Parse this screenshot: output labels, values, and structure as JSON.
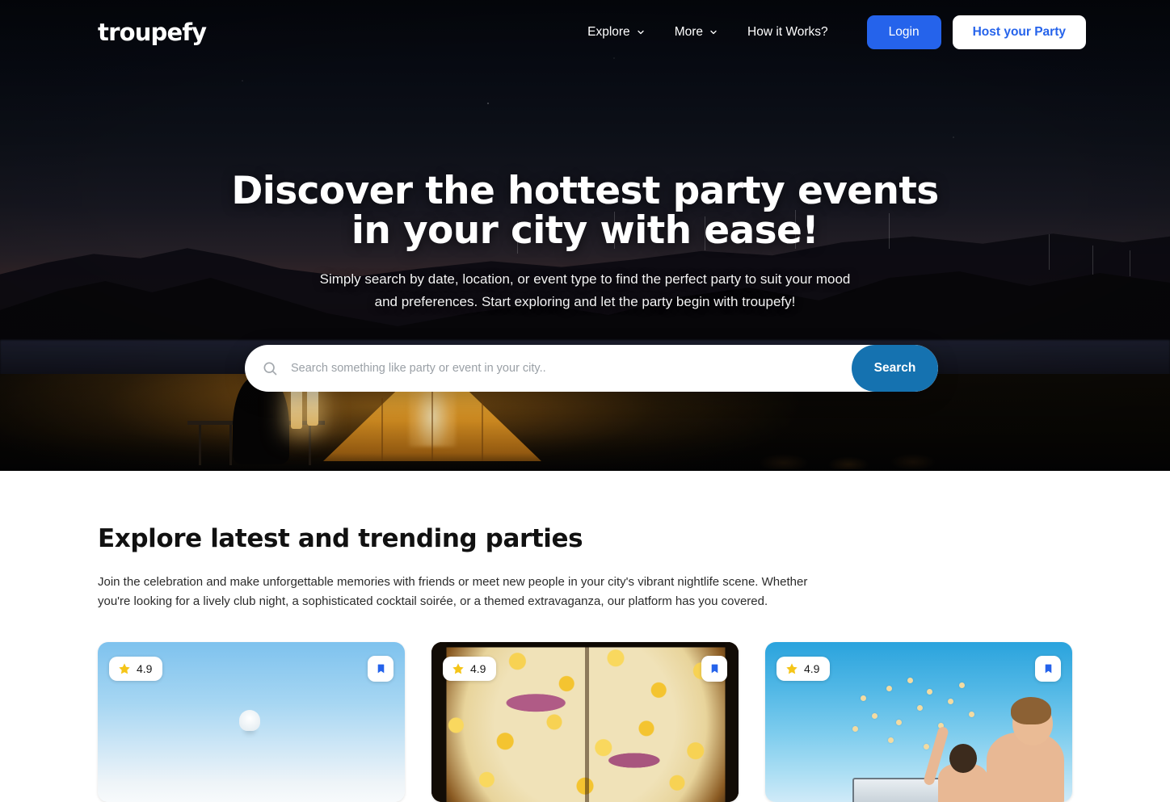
{
  "brand": {
    "logo_text": "troupefy"
  },
  "nav": {
    "links": [
      {
        "label": "Explore",
        "icon": "chevron-down-icon"
      },
      {
        "label": "More",
        "icon": "chevron-down-icon"
      },
      {
        "label": "How it Works?",
        "icon": ""
      }
    ],
    "login_label": "Login",
    "host_label": "Host your Party",
    "login_bg": "#2563EB",
    "host_text_color": "#2563EB"
  },
  "hero": {
    "title_line1": "Discover the hottest party events",
    "title_line2": "in your city with ease!",
    "subtitle_line1": "Simply search by date, location, or event type to find the perfect party to suit your mood",
    "subtitle_line2": "and preferences. Start exploring and let the party begin with troupefy!"
  },
  "search": {
    "icon": "search-icon",
    "placeholder": "Search something like party or event in your city..",
    "value": "",
    "button_label": "Search",
    "button_bg": "#1572B0"
  },
  "explore": {
    "heading": "Explore latest and trending parties",
    "description": "Join the celebration and make unforgettable memories with friends or meet new people in your city's vibrant nightlife scene. Whether you're looking for a lively club night, a sophisticated cocktail soirée, or a themed extravaganza, our platform has you covered.",
    "cards": [
      {
        "rating": "4.9",
        "rating_icon": "star-icon",
        "bookmark_icon": "bookmark-icon",
        "media": "sky"
      },
      {
        "rating": "4.9",
        "rating_icon": "star-icon",
        "bookmark_icon": "bookmark-icon",
        "media": "pizza"
      },
      {
        "rating": "4.9",
        "rating_icon": "star-icon",
        "bookmark_icon": "bookmark-icon",
        "media": "beach"
      }
    ]
  },
  "colors": {
    "star": "#F5C518",
    "bookmark": "#2563EB",
    "accent_blue": "#2563EB",
    "search_blue": "#1572B0"
  }
}
